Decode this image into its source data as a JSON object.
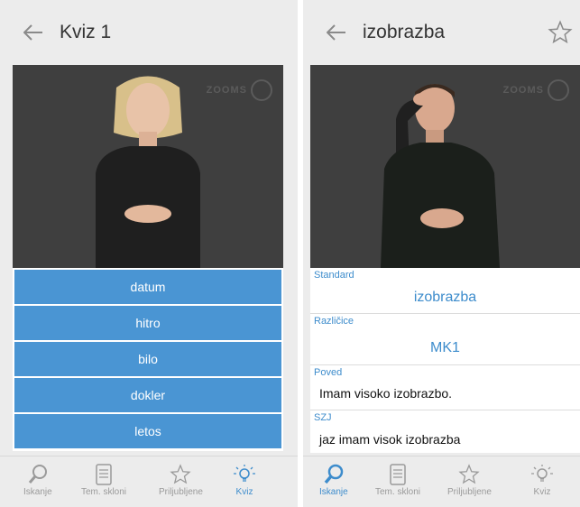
{
  "left": {
    "title": "Kviz 1",
    "watermark": "ZOOMS",
    "answers": [
      "datum",
      "hitro",
      "bilo",
      "dokler",
      "letos"
    ],
    "nav": [
      {
        "label": "Iskanje",
        "icon": "search-icon"
      },
      {
        "label": "Tem. skloni",
        "icon": "document-icon"
      },
      {
        "label": "Priljubljene",
        "icon": "star-icon"
      },
      {
        "label": "Kviz",
        "icon": "lightbulb-icon",
        "active": true
      }
    ]
  },
  "right": {
    "title": "izobrazba",
    "watermark": "ZOOMS",
    "fields": {
      "standard_label": "Standard",
      "standard_value": "izobrazba",
      "variants_label": "Različice",
      "variants_value": "MK1",
      "sentence_label": "Poved",
      "sentence_value": "Imam visoko izobrazbo.",
      "szj_label": "SZJ",
      "szj_value": "jaz imam visok izobrazba"
    },
    "nav": [
      {
        "label": "Iskanje",
        "icon": "search-icon",
        "active": true
      },
      {
        "label": "Tem. skloni",
        "icon": "document-icon"
      },
      {
        "label": "Priljubljene",
        "icon": "star-icon"
      },
      {
        "label": "Kviz",
        "icon": "lightbulb-icon"
      }
    ]
  },
  "colors": {
    "accent": "#3d8ccc",
    "answer_bg": "#4a95d3",
    "chrome": "#ececec",
    "video_bg": "#3f3f3f"
  }
}
